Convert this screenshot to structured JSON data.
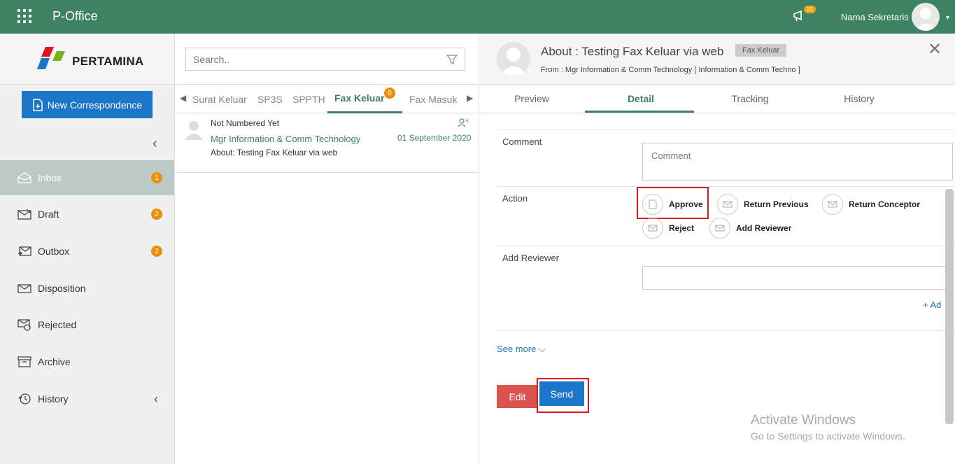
{
  "topbar": {
    "app_title": "P-Office",
    "notification_count": "21",
    "user_name": "Nama Sekretaris"
  },
  "sidebar": {
    "logo_text": "PERTAMINA",
    "new_button": "New Correspondence",
    "items": [
      {
        "label": "Inbox",
        "badge": "1",
        "icon": "inbox-icon"
      },
      {
        "label": "Draft",
        "badge": "2",
        "icon": "draft-icon"
      },
      {
        "label": "Outbox",
        "badge": "2",
        "icon": "outbox-icon"
      },
      {
        "label": "Disposition",
        "badge": "",
        "icon": "disposition-icon"
      },
      {
        "label": "Rejected",
        "badge": "",
        "icon": "rejected-icon"
      },
      {
        "label": "Archive",
        "badge": "",
        "icon": "archive-icon"
      },
      {
        "label": "History",
        "badge": "",
        "icon": "history-icon"
      }
    ]
  },
  "list": {
    "search_placeholder": "Search..",
    "tabs": [
      {
        "label": "Surat Keluar"
      },
      {
        "label": "SP3S"
      },
      {
        "label": "SPPTH"
      },
      {
        "label": "Fax Keluar",
        "badge": "0"
      },
      {
        "label": "Fax Masuk"
      }
    ],
    "item": {
      "status": "Not Numbered Yet",
      "from": "Mgr Information & Comm Technology",
      "about": "About: Testing Fax Keluar via web",
      "date": "01 September 2020"
    }
  },
  "detail": {
    "title": "About : Testing Fax Keluar via web",
    "tag": "Fax Keluar",
    "from": "From : Mgr Information & Comm Technology [ Information & Comm Techno ]",
    "tabs": [
      "Preview",
      "Detail",
      "Tracking",
      "History"
    ],
    "comment_label": "Comment",
    "comment_placeholder": "Comment",
    "action_label": "Action",
    "actions": [
      "Approve",
      "Return Previous",
      "Return Conceptor",
      "Reject",
      "Add Reviewer"
    ],
    "add_reviewer_label": "Add Reviewer",
    "add_link": "Ad",
    "see_more": "See more",
    "edit_button": "Edit",
    "send_button": "Send"
  },
  "watermark": {
    "line1": "Activate Windows",
    "line2": "Go to Settings to activate Windows."
  },
  "colors": {
    "brand_green": "#3e8261",
    "primary_blue": "#1b75c8",
    "badge_orange": "#e8900a",
    "danger_red": "#d9534f",
    "highlight_red": "#e0141c"
  }
}
